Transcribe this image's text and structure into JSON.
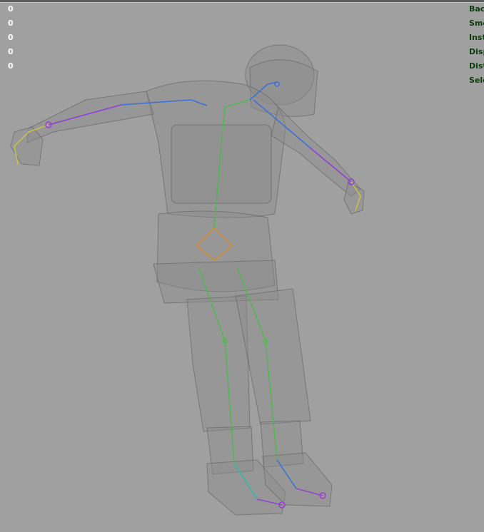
{
  "hud": {
    "values": [
      "0",
      "0",
      "0",
      "0",
      "0"
    ],
    "labels": [
      "Bac",
      "Smo",
      "Inst",
      "Disp",
      "Dist",
      "Sele"
    ]
  },
  "scene": {
    "subject-icon": "rigged-soldier-model-icon",
    "colors": {
      "background": "#a0a0a0",
      "mesh": "#8c8c8c",
      "hud_value": "#ffffff",
      "hud_label": "#0b3d0b",
      "bone_blue": "#3b6fd8",
      "bone_purple": "#9a3fd4",
      "bone_green": "#4fb84f",
      "bone_orange": "#d48a2b",
      "bone_yellow": "#c9c24a",
      "bone_cyan": "#2fb6b6"
    }
  }
}
